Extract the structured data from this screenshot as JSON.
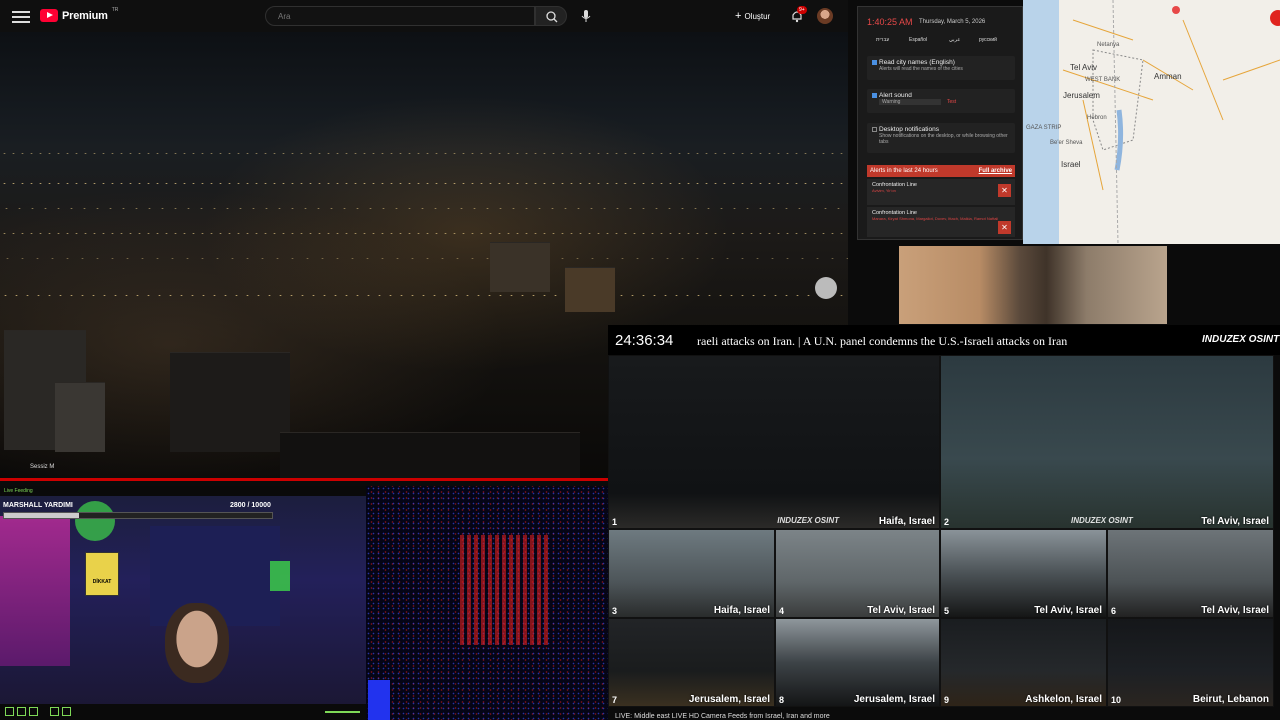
{
  "youtube": {
    "logo_text": "Premium",
    "region": "TR",
    "search_placeholder": "Ara",
    "create_label": "Oluştur",
    "notification_count": "9+",
    "muted_label": "Sessiz",
    "muted_key": "M"
  },
  "alert_panel": {
    "time": "1:40:25 AM",
    "date": "Thursday, March 5, 2026",
    "languages": [
      "עברית",
      "Español",
      "عربي",
      "русский"
    ],
    "options": [
      {
        "title": "Read city names (English)",
        "subtitle": "Alerts will read the names of the cities",
        "checked": true
      },
      {
        "title": "Alert sound",
        "subtitle": "Warning",
        "checked": true,
        "test_label": "Test"
      },
      {
        "title": "Desktop notifications",
        "subtitle": "Show notifications on the desktop, or while browsing other tabs",
        "checked": false
      }
    ],
    "alerts_header": "Alerts in the last 24 hours",
    "archive_link": "Full archive",
    "alerts": [
      {
        "name": "Confrontation Line",
        "detail": "Avivim, Yir'on"
      },
      {
        "name": "Confrontation Line",
        "detail": "Manara, Kiryat Shmona, Margaliot, Dovev, Ittach, Malkia, Ramot Naftali"
      }
    ]
  },
  "map": {
    "labels": [
      "Netanya",
      "Tel Aviv",
      "Amman",
      "WEST BANK",
      "Jerusalem",
      "GAZA STRIP",
      "Hebron",
      "Be'er Sheva",
      "Israel"
    ]
  },
  "ticker": {
    "clock": "24:36:34",
    "text": "raeli attacks on Iran.    |    A U.N. panel condemns the U.S.-Israeli attacks on Iran",
    "logo": "INDUZEX OSINT"
  },
  "cameras": [
    {
      "num": "1",
      "location": "Haifa, Israel"
    },
    {
      "num": "2",
      "location": "Tel Aviv, Israel"
    },
    {
      "num": "3",
      "location": "Haifa, Israel"
    },
    {
      "num": "4",
      "location": "Tel Aviv, Israel"
    },
    {
      "num": "5",
      "location": "Tel Aviv, Israel"
    },
    {
      "num": "6",
      "location": "Tel Aviv, Israel"
    },
    {
      "num": "7",
      "location": "Jerusalem, Israel"
    },
    {
      "num": "8",
      "location": "Jerusalem, Israel"
    },
    {
      "num": "9",
      "location": "Ashkelon, Israel"
    },
    {
      "num": "10",
      "location": "Beirut, Lebanon"
    }
  ],
  "camera_watermark": "INDUZEX OSINT",
  "bottom_caption": "LIVE: Middle east LIVE HD Camera Feeds from Israel, Iran and more",
  "stream": {
    "header": "Live Feeding",
    "boss_name": "MARSHALL YARDIMI",
    "boss_hp": "2800 / 10000",
    "boss_hp_fraction": 0.28,
    "sign_text": "DİKKAT"
  }
}
